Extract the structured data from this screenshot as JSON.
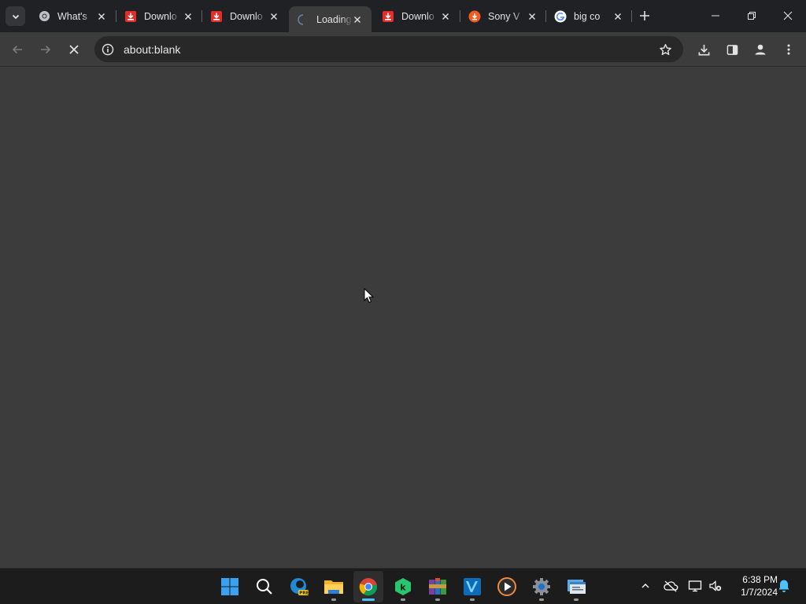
{
  "browser": {
    "tabs": [
      {
        "title": "What's",
        "favicon": "chrome-icon",
        "active": false
      },
      {
        "title": "Downlo",
        "favicon": "download-red-icon",
        "active": false
      },
      {
        "title": "Downlo",
        "favicon": "download-red-icon",
        "active": false
      },
      {
        "title": "Loading",
        "favicon": "loading-spinner-icon",
        "active": true
      },
      {
        "title": "Downlo",
        "favicon": "download-red-icon",
        "active": false
      },
      {
        "title": "Sony V",
        "favicon": "sony-orange-icon",
        "active": false
      },
      {
        "title": "big co",
        "favicon": "google-icon",
        "active": false
      }
    ],
    "address_bar": {
      "url": "about:blank"
    },
    "toolbar_icons": [
      "back-icon",
      "forward-icon",
      "stop-loading-icon",
      "site-info-icon",
      "bookmark-star-icon",
      "downloads-icon",
      "side-panel-icon",
      "profile-icon",
      "menu-icon"
    ],
    "window_controls": [
      "minimize-icon",
      "restore-icon",
      "close-icon"
    ]
  },
  "taskbar": {
    "apps": [
      "windows-start-icon",
      "search-icon",
      "edge-pre-icon",
      "file-explorer-icon",
      "chrome-icon",
      "kotlin-ide-icon",
      "winrar-icon",
      "visual-studio-icon",
      "media-player-icon",
      "settings-icon",
      "terminal-window-icon"
    ],
    "tray": [
      "show-hidden-icons-chevron",
      "onedrive-offline-icon",
      "display-icon",
      "speaker-muted-icon",
      "notifications-bell-icon"
    ],
    "clock": {
      "time": "6:38 PM",
      "date": "1/7/2024"
    }
  },
  "colors": {
    "chrome_dark": "#202124",
    "toolbar": "#3c3c3c",
    "omnibox": "#282828",
    "taskbar": "#1c1c1c",
    "accent": "#4cc2ff"
  }
}
